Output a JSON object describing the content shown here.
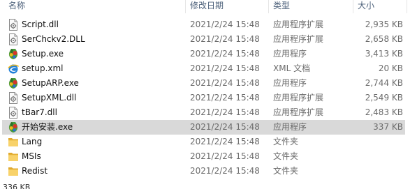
{
  "columns": {
    "name": "名称",
    "modified": "修改日期",
    "type": "类型",
    "size": "大小"
  },
  "files": [
    {
      "name": "Script.dll",
      "modified": "2021/2/24 15:48",
      "type": "应用程序扩展",
      "size": "2,935 KB",
      "icon": "dll-icon"
    },
    {
      "name": "SerChckv2.DLL",
      "modified": "2021/2/24 15:48",
      "type": "应用程序扩展",
      "size": "2,658 KB",
      "icon": "dll-icon"
    },
    {
      "name": "Setup.exe",
      "modified": "2021/2/24 15:48",
      "type": "应用程序",
      "size": "3,413 KB",
      "icon": "setup-exe-icon"
    },
    {
      "name": "setup.xml",
      "modified": "2021/2/24 15:48",
      "type": "XML 文档",
      "size": "20 KB",
      "icon": "xml-document-icon"
    },
    {
      "name": "SetupARP.exe",
      "modified": "2021/2/24 15:48",
      "type": "应用程序",
      "size": "2,744 KB",
      "icon": "setup-exe-icon"
    },
    {
      "name": "SetupXML.dll",
      "modified": "2021/2/24 15:48",
      "type": "应用程序扩展",
      "size": "2,549 KB",
      "icon": "dll-icon"
    },
    {
      "name": "tBar7.dll",
      "modified": "2021/2/24 15:48",
      "type": "应用程序扩展",
      "size": "2,483 KB",
      "icon": "dll-icon"
    },
    {
      "name": "开始安装.exe",
      "modified": "2021/2/24 15:48",
      "type": "应用程序",
      "size": "337 KB",
      "icon": "setup-exe-icon",
      "selected": true
    },
    {
      "name": "Lang",
      "modified": "2021/2/24 15:48",
      "type": "文件夹",
      "size": "",
      "icon": "folder-icon"
    },
    {
      "name": "MSIs",
      "modified": "2021/2/24 15:48",
      "type": "文件夹",
      "size": "",
      "icon": "folder-icon"
    },
    {
      "name": "Redist",
      "modified": "2021/2/24 15:48",
      "type": "文件夹",
      "size": "",
      "icon": "folder-icon"
    }
  ],
  "status_bar": {
    "text": "336 KB"
  },
  "colors": {
    "header_text": "#4c607a",
    "selected_row": "#d9d9d9",
    "folder": "#f4c542"
  }
}
